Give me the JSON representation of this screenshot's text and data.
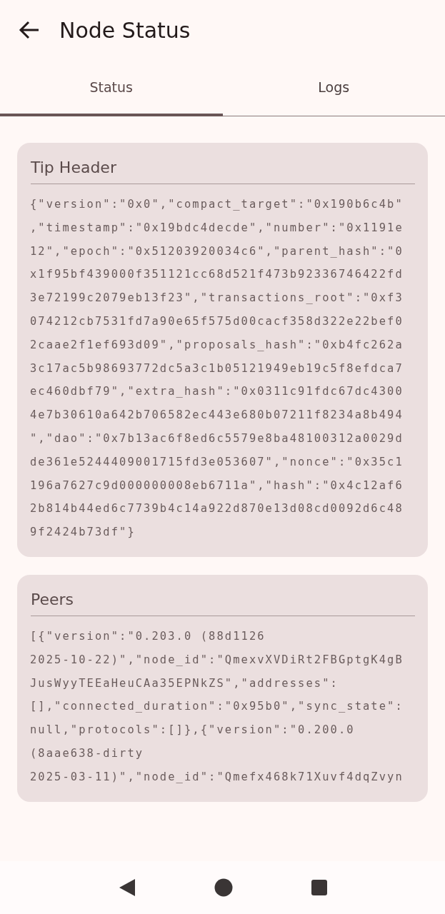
{
  "app_bar": {
    "title": "Node Status"
  },
  "tabs": [
    {
      "label": "Status",
      "selected": true
    },
    {
      "label": "Logs",
      "selected": false
    }
  ],
  "cards": [
    {
      "title": "Tip Header",
      "lines": [
        "{\"version\":\"0x0\",\"compact_target\":\"0x190b6c4b\"",
        ",\"timestamp\":\"0x19bdc4decde\",\"number\":\"0x1191e",
        "12\",\"epoch\":\"0x51203920034c6\",\"parent_hash\":\"0",
        "x1f95bf439000f351121cc68d521f473b92336746422fd",
        "3e72199c2079eb13f23\",\"transactions_root\":\"0xf3",
        "074212cb7531fd7a90e65f575d00cacf358d322e22bef0",
        "2caae2f1ef693d09\",\"proposals_hash\":\"0xb4fc262a",
        "3c17ac5b98693772dc5a3c1b05121949eb19c5f8efdca7",
        "ec460dbf79\",\"extra_hash\":\"0x0311c91fdc67dc4300",
        "4e7b30610a642b706582ec443e680b07211f8234a8b494",
        "\",\"dao\":\"0x7b13ac6f8ed6c5579e8ba48100312a0029d",
        "de361e5244409001715fd3e053607\",\"nonce\":\"0x35c1",
        "196a7627c9d000000008eb6711a\",\"hash\":\"0x4c12af6",
        "2b814b44ed6c7739b4c14a922d870e13d08cd0092d6c48",
        "9f2424b73df\"}"
      ]
    },
    {
      "title": "Peers",
      "lines": [
        "[{\"version\":\"0.203.0 (88d1126",
        "2025-10-22)\",\"node_id\":\"QmexvXVDiRt2FBGptgK4gB",
        "JusWyyTEEaHeuCAa35EPNkZS\",\"addresses\":",
        "[],\"connected_duration\":\"0x95b0\",\"sync_state\":",
        "null,\"protocols\":[]},{\"version\":\"0.200.0",
        "(8aae638-dirty",
        "2025-03-11)\",\"node_id\":\"Qmefx468k71Xuvf4dqZvyn"
      ]
    }
  ]
}
